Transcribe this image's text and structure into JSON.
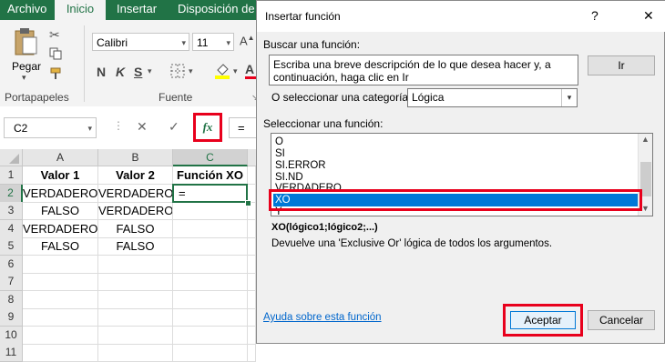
{
  "ribbon": {
    "tabs": [
      "Archivo",
      "Inicio",
      "Insertar",
      "Disposición de p"
    ],
    "active_tab": "Inicio",
    "paste_label": "Pegar",
    "clipboard_label": "Portapapeles",
    "font_name": "Calibri",
    "font_size": "11",
    "bold": "N",
    "italic": "K",
    "underline": "S",
    "font_group_label": "Fuente"
  },
  "formula_bar": {
    "name_box": "C2",
    "fx_label": "fx",
    "content": "="
  },
  "grid": {
    "columns": [
      "A",
      "B",
      "C"
    ],
    "rows": [
      "1",
      "2",
      "3",
      "4",
      "5",
      "6",
      "7",
      "8",
      "9",
      "10",
      "11"
    ],
    "cells": [
      [
        "Valor 1",
        "Valor 2",
        "Función XO"
      ],
      [
        "VERDADERO",
        "VERDADERO",
        "="
      ],
      [
        "FALSO",
        "VERDADERO",
        ""
      ],
      [
        "VERDADERO",
        "FALSO",
        ""
      ],
      [
        "FALSO",
        "FALSO",
        ""
      ],
      [
        "",
        "",
        ""
      ],
      [
        "",
        "",
        ""
      ],
      [
        "",
        "",
        ""
      ],
      [
        "",
        "",
        ""
      ],
      [
        "",
        "",
        ""
      ],
      [
        "",
        "",
        ""
      ]
    ]
  },
  "dialog": {
    "title": "Insertar función",
    "help_glyph": "?",
    "close_glyph": "✕",
    "search_label": "Buscar una función:",
    "search_text": "Escriba una breve descripción de lo que desea hacer y, a continuación, haga clic en Ir",
    "go_button": "Ir",
    "category_label": "O seleccionar una categoría:",
    "category_value": "Lógica",
    "select_label": "Seleccionar una función:",
    "functions": [
      "O",
      "SI",
      "SI.ERROR",
      "SI.ND",
      "VERDADERO",
      "XO",
      "Y"
    ],
    "selected_function": "XO",
    "signature": "XO(lógico1;lógico2;...)",
    "description": "Devuelve una 'Exclusive Or' lógica de todos los argumentos.",
    "help_link": "Ayuda sobre esta función",
    "ok_button": "Aceptar",
    "cancel_button": "Cancelar"
  },
  "colors": {
    "excel_green": "#217346",
    "highlight_red": "#e8001c",
    "selection_blue": "#0078d7"
  }
}
